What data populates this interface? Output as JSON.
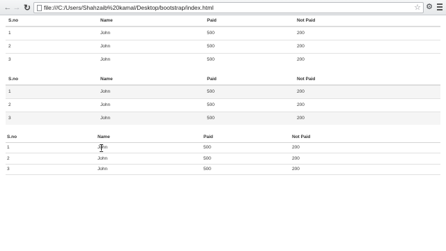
{
  "browser": {
    "url": "file:///C:/Users/Shahzaib%20kamal/Desktop/bootstrap/index.html",
    "back_icon": "arrow-left-icon",
    "forward_icon": "arrow-right-icon",
    "reload_icon": "reload-icon",
    "star_icon": "star-icon",
    "menu_icon": "wrench-icon"
  },
  "tables": [
    {
      "headers": [
        "S.no",
        "Name",
        "Paid",
        "Not Paid"
      ],
      "rows": [
        [
          "1",
          "John",
          "500",
          "200"
        ],
        [
          "2",
          "John",
          "500",
          "200"
        ],
        [
          "3",
          "John",
          "500",
          "200"
        ]
      ]
    },
    {
      "headers": [
        "S.no",
        "Name",
        "Paid",
        "Not Paid"
      ],
      "rows": [
        [
          "1",
          "John",
          "500",
          "200"
        ],
        [
          "2",
          "John",
          "500",
          "200"
        ],
        [
          "3",
          "John",
          "500",
          "200"
        ]
      ]
    },
    {
      "headers": [
        "S.no",
        "Name",
        "Paid",
        "Not Paid"
      ],
      "rows": [
        [
          "1",
          "John",
          "500",
          "200"
        ],
        [
          "2",
          "John",
          "500",
          "200"
        ],
        [
          "3",
          "John",
          "500",
          "200"
        ]
      ]
    }
  ]
}
